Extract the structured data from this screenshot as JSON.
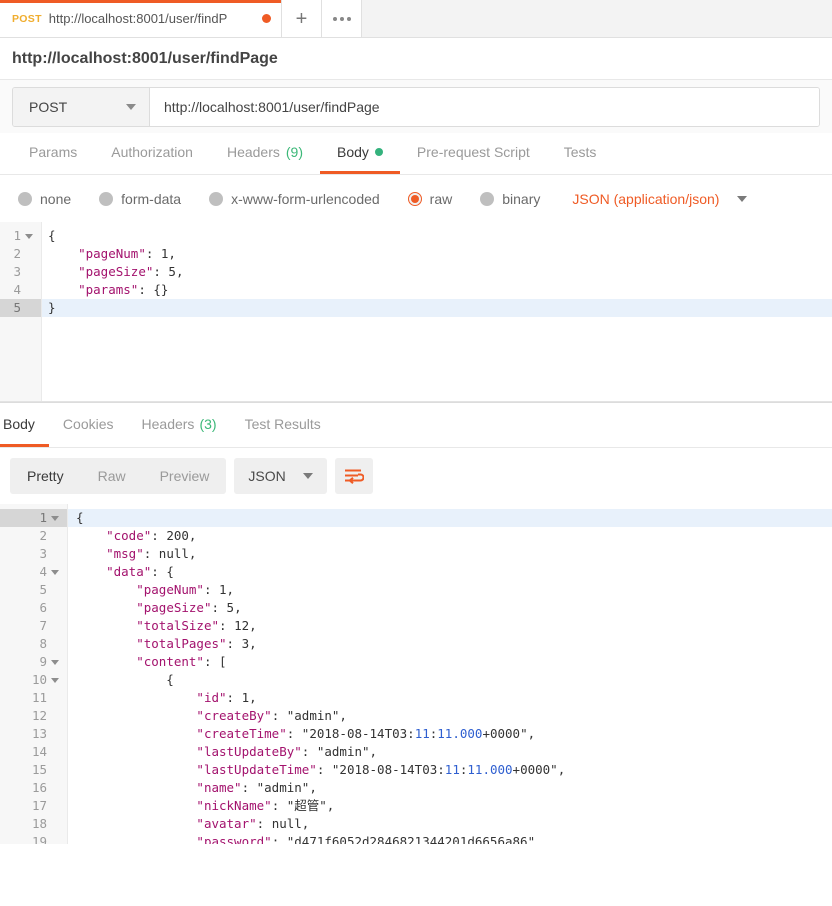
{
  "tabbar": {
    "active_tab": {
      "method": "POST",
      "url": "http://localhost:8001/user/findP",
      "unsaved_icon": "unsaved-dot"
    },
    "new_tab_icon": "plus-icon",
    "more_icon": "ellipsis-icon"
  },
  "page_title": "http://localhost:8001/user/findPage",
  "request": {
    "method": "POST",
    "method_caret_icon": "chevron-down-icon",
    "url": "http://localhost:8001/user/findPage",
    "tabs": [
      {
        "label": "Params",
        "active": false,
        "count": ""
      },
      {
        "label": "Authorization",
        "active": false,
        "count": ""
      },
      {
        "label": "Headers",
        "active": false,
        "count": "(9)"
      },
      {
        "label": "Body",
        "active": true,
        "count": ""
      },
      {
        "label": "Pre-request Script",
        "active": false,
        "count": ""
      },
      {
        "label": "Tests",
        "active": false,
        "count": ""
      }
    ],
    "body_types": [
      {
        "label": "none",
        "selected": false
      },
      {
        "label": "form-data",
        "selected": false
      },
      {
        "label": "x-www-form-urlencoded",
        "selected": false
      },
      {
        "label": "raw",
        "selected": true
      },
      {
        "label": "binary",
        "selected": false
      }
    ],
    "format_label": "JSON (application/json)",
    "format_caret_icon": "chevron-down-icon",
    "body_lines": [
      {
        "num": "1",
        "fold": true,
        "active": false,
        "text": "{"
      },
      {
        "num": "2",
        "fold": false,
        "active": false,
        "text": "    \"pageNum\": 1,"
      },
      {
        "num": "3",
        "fold": false,
        "active": false,
        "text": "    \"pageSize\": 5,"
      },
      {
        "num": "4",
        "fold": false,
        "active": false,
        "text": "    \"params\": {}"
      },
      {
        "num": "5",
        "fold": false,
        "active": true,
        "text": "}"
      }
    ]
  },
  "response": {
    "tabs": [
      {
        "label": "Body",
        "active": true,
        "count": ""
      },
      {
        "label": "Cookies",
        "active": false,
        "count": ""
      },
      {
        "label": "Headers",
        "active": false,
        "count": "(3)"
      },
      {
        "label": "Test Results",
        "active": false,
        "count": ""
      }
    ],
    "view_modes": [
      {
        "label": "Pretty",
        "active": true
      },
      {
        "label": "Raw",
        "active": false
      },
      {
        "label": "Preview",
        "active": false
      }
    ],
    "format_label": "JSON",
    "format_caret_icon": "chevron-down-icon",
    "wrap_icon": "word-wrap-icon",
    "body_lines": [
      {
        "num": "1",
        "fold": true,
        "active": true,
        "text": "{"
      },
      {
        "num": "2",
        "fold": false,
        "active": false,
        "text": "    \"code\": 200,"
      },
      {
        "num": "3",
        "fold": false,
        "active": false,
        "text": "    \"msg\": null,"
      },
      {
        "num": "4",
        "fold": true,
        "active": false,
        "text": "    \"data\": {"
      },
      {
        "num": "5",
        "fold": false,
        "active": false,
        "text": "        \"pageNum\": 1,"
      },
      {
        "num": "6",
        "fold": false,
        "active": false,
        "text": "        \"pageSize\": 5,"
      },
      {
        "num": "7",
        "fold": false,
        "active": false,
        "text": "        \"totalSize\": 12,"
      },
      {
        "num": "8",
        "fold": false,
        "active": false,
        "text": "        \"totalPages\": 3,"
      },
      {
        "num": "9",
        "fold": true,
        "active": false,
        "text": "        \"content\": ["
      },
      {
        "num": "10",
        "fold": true,
        "active": false,
        "text": "            {"
      },
      {
        "num": "11",
        "fold": false,
        "active": false,
        "text": "                \"id\": 1,"
      },
      {
        "num": "12",
        "fold": false,
        "active": false,
        "text": "                \"createBy\": \"admin\","
      },
      {
        "num": "13",
        "fold": false,
        "active": false,
        "text": "                \"createTime\": \"2018-08-14T03:11:11.000+0000\","
      },
      {
        "num": "14",
        "fold": false,
        "active": false,
        "text": "                \"lastUpdateBy\": \"admin\","
      },
      {
        "num": "15",
        "fold": false,
        "active": false,
        "text": "                \"lastUpdateTime\": \"2018-08-14T03:11:11.000+0000\","
      },
      {
        "num": "16",
        "fold": false,
        "active": false,
        "text": "                \"name\": \"admin\","
      },
      {
        "num": "17",
        "fold": false,
        "active": false,
        "text": "                \"nickName\": \"超管\","
      },
      {
        "num": "18",
        "fold": false,
        "active": false,
        "text": "                \"avatar\": null,"
      },
      {
        "num": "19",
        "fold": false,
        "active": false,
        "text": "                \"password\": \"d471f6052d2846821344201d6656a86\""
      }
    ]
  },
  "colors": {
    "accent": "#ef5b25",
    "method_post": "#f0ad2e",
    "green": "#34b27d",
    "json_key": "#a3126d",
    "json_value": "#2f5fd0",
    "active_line": "#e8f1fb"
  }
}
